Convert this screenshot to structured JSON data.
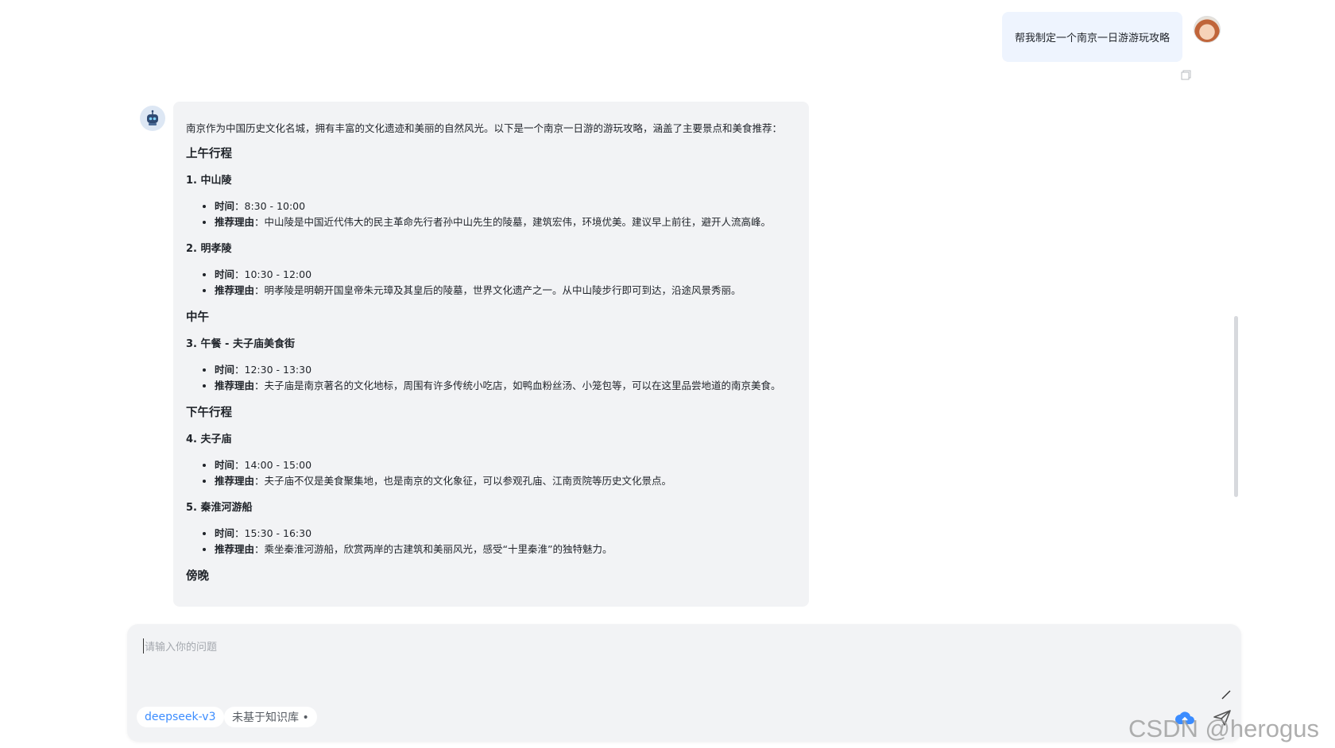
{
  "user_message": {
    "text": "帮我制定一个南京一日游游玩攻略"
  },
  "bot_message": {
    "intro": "南京作为中国历史文化名城，拥有丰富的文化遗迹和美丽的自然风光。以下是一个南京一日游的游玩攻略，涵盖了主要景点和美食推荐：",
    "sections": [
      {
        "heading": "上午行程",
        "items": [
          {
            "title": "1. 中山陵",
            "time_label": "时间",
            "time": "：8:30 - 10:00",
            "reason_label": "推荐理由",
            "reason": "：中山陵是中国近代伟大的民主革命先行者孙中山先生的陵墓，建筑宏伟，环境优美。建议早上前往，避开人流高峰。"
          },
          {
            "title": "2. 明孝陵",
            "time_label": "时间",
            "time": "：10:30 - 12:00",
            "reason_label": "推荐理由",
            "reason": "：明孝陵是明朝开国皇帝朱元璋及其皇后的陵墓，世界文化遗产之一。从中山陵步行即可到达，沿途风景秀丽。"
          }
        ]
      },
      {
        "heading": "中午",
        "items": [
          {
            "title": "3. 午餐 - 夫子庙美食街",
            "time_label": "时间",
            "time": "：12:30 - 13:30",
            "reason_label": "推荐理由",
            "reason": "：夫子庙是南京著名的文化地标，周围有许多传统小吃店，如鸭血粉丝汤、小笼包等，可以在这里品尝地道的南京美食。"
          }
        ]
      },
      {
        "heading": "下午行程",
        "items": [
          {
            "title": "4. 夫子庙",
            "time_label": "时间",
            "time": "：14:00 - 15:00",
            "reason_label": "推荐理由",
            "reason": "：夫子庙不仅是美食聚集地，也是南京的文化象征，可以参观孔庙、江南贡院等历史文化景点。"
          },
          {
            "title": "5. 秦淮河游船",
            "time_label": "时间",
            "time": "：15:30 - 16:30",
            "reason_label": "推荐理由",
            "reason": "：乘坐秦淮河游船，欣赏两岸的古建筑和美丽风光，感受“十里秦淮”的独特魅力。"
          }
        ]
      },
      {
        "heading": "傍晚",
        "items": []
      }
    ]
  },
  "input": {
    "placeholder": "请输入你的问题",
    "model_tag": "deepseek-v3",
    "kb_tag": "未基于知识库 •"
  },
  "watermark": "CSDN @herogus",
  "icons": [
    "copy-icon",
    "user-avatar",
    "bot-avatar",
    "edit-icon",
    "upload-icon",
    "send-icon"
  ],
  "colors": {
    "user_bubble": "#eef4fe",
    "bot_bubble": "#f2f3f5",
    "accent": "#3b8cff"
  }
}
